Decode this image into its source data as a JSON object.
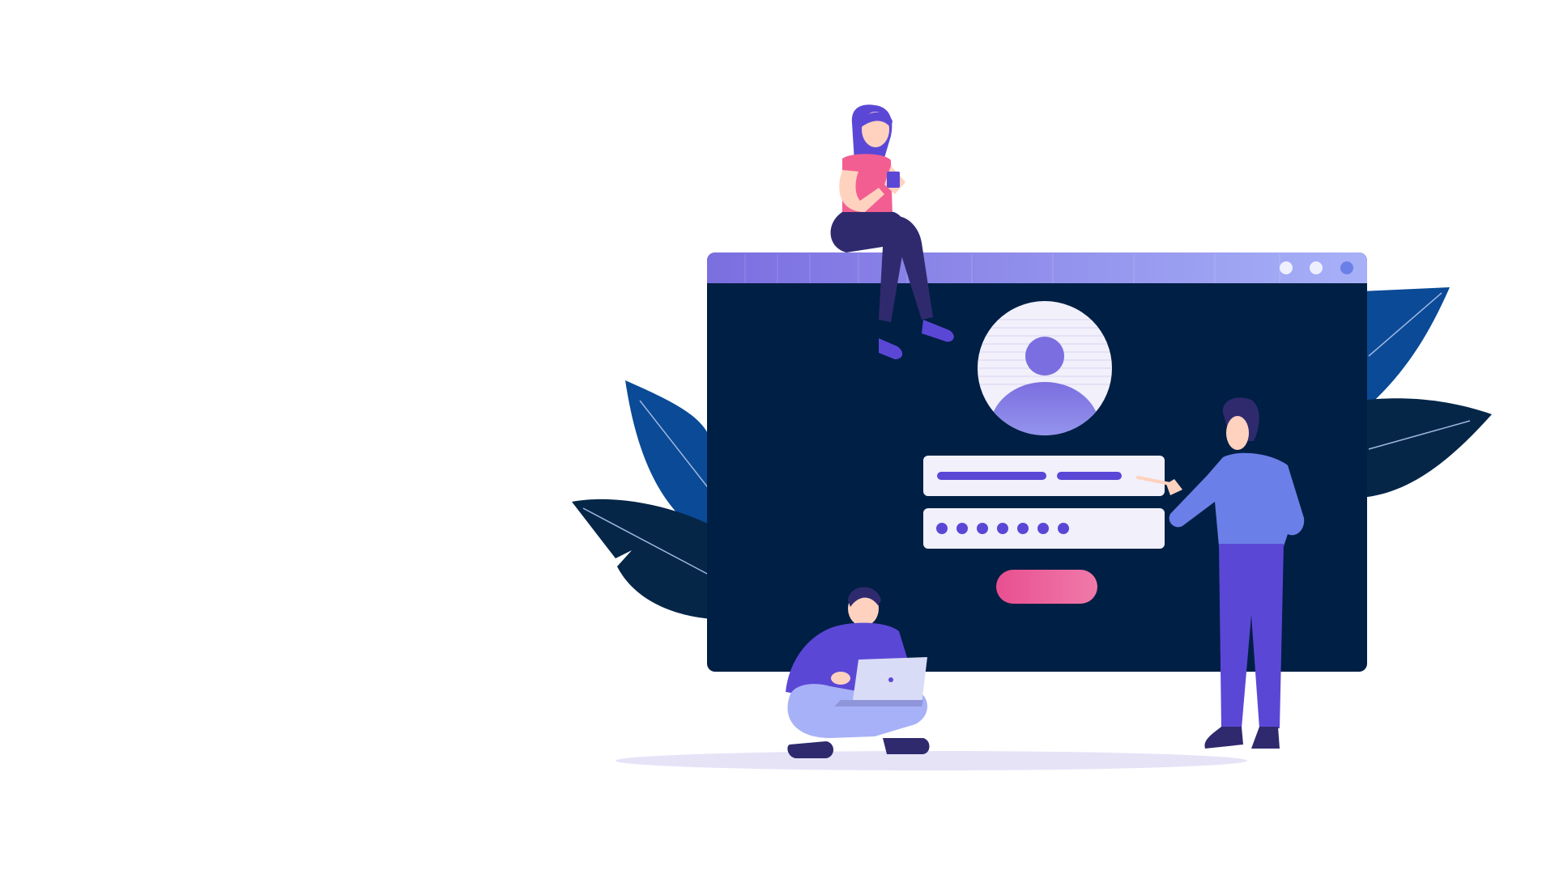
{
  "scene": {
    "background_color": "#ffffff",
    "description_icons": {
      "window": "browser-window-icon",
      "avatar": "user-avatar-icon",
      "login_button": "pill-button-icon"
    }
  },
  "browser_window": {
    "title_bar_gradient": [
      "#7b6ee0",
      "#a7b1f7"
    ],
    "body_color": "#001f44",
    "window_controls": [
      "minimize-dot",
      "maximize-dot",
      "close-dot"
    ]
  },
  "login_form": {
    "username_value": "",
    "password_masked_dots": 7,
    "accent_color": "#5b47d6",
    "button_color": "#e84f90"
  },
  "decor": {
    "leaf_colors": [
      "#0a4a96",
      "#062648"
    ],
    "shadow_color": "#e6e3f7"
  },
  "characters": [
    {
      "role": "woman-sitting-on-window",
      "icon": "woman-with-phone-icon"
    },
    {
      "role": "man-sitting-with-laptop",
      "icon": "man-with-laptop-icon"
    },
    {
      "role": "man-pointing-at-form",
      "icon": "man-pointing-icon"
    }
  ]
}
